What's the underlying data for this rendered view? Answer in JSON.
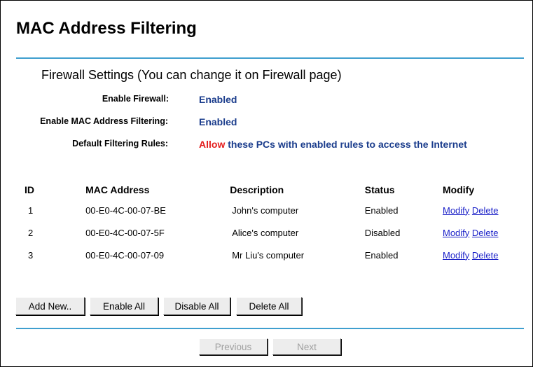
{
  "page": {
    "title": "MAC Address Filtering"
  },
  "firewall": {
    "section_title": "Firewall Settings (You can change it on Firewall page)",
    "enable_firewall_label": "Enable Firewall:",
    "enable_firewall_value": "Enabled",
    "enable_mac_label": "Enable MAC Address Filtering:",
    "enable_mac_value": "Enabled",
    "default_rules_label": "Default Filtering Rules:",
    "default_rules_action": "Allow",
    "default_rules_text": "these PCs with enabled rules to access the Internet"
  },
  "table": {
    "headers": {
      "id": "ID",
      "mac": "MAC Address",
      "desc": "Description",
      "status": "Status",
      "modify": "Modify"
    },
    "rows": [
      {
        "id": "1",
        "mac": "00-E0-4C-00-07-BE",
        "desc": "John's computer",
        "status": "Enabled",
        "modify": "Modify",
        "delete": "Delete"
      },
      {
        "id": "2",
        "mac": "00-E0-4C-00-07-5F",
        "desc": "Alice's computer",
        "status": "Disabled",
        "modify": "Modify",
        "delete": "Delete"
      },
      {
        "id": "3",
        "mac": "00-E0-4C-00-07-09",
        "desc": "Mr Liu's computer",
        "status": "Enabled",
        "modify": "Modify",
        "delete": "Delete"
      }
    ]
  },
  "buttons": {
    "add_new": "Add New..",
    "enable_all": "Enable All",
    "disable_all": "Disable All",
    "delete_all": "Delete All",
    "previous": "Previous",
    "next": "Next"
  },
  "colors": {
    "accent_line": "#3f9fcf",
    "value_blue": "#1a3c8c",
    "allow_red": "#e41c1c",
    "link_blue": "#1a20c8"
  }
}
